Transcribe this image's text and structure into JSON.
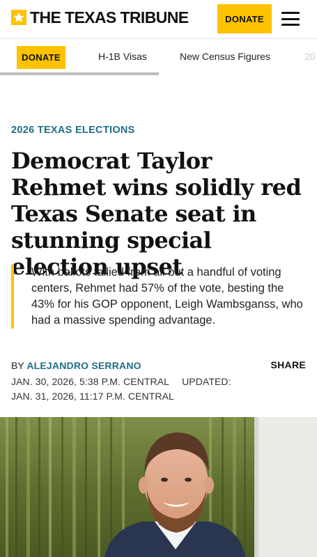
{
  "header": {
    "logo_text": "THE TEXAS TRIBUNE",
    "donate_label": "DONATE"
  },
  "nav": {
    "donate_label": "DONATE",
    "links": [
      "H-1B Visas",
      "New Census Figures",
      "20"
    ]
  },
  "article": {
    "kicker": "2026 TEXAS ELECTIONS",
    "headline": "Democrat Taylor Rehmet wins solidly red Texas Senate seat in stunning special election upset",
    "dek": "With ballots tallied from all but a handful of voting centers, Rehmet had 57% of the vote, besting the 43% for his GOP opponent, Leigh Wambsganss, who had a massive spending advantage.",
    "byline_prefix": "BY",
    "author": "Alejandro Serrano",
    "share_label": "SHARE",
    "published": "JAN. 30, 2026, 5:38 P.M. CENTRAL",
    "updated_label": "UPDATED:",
    "updated": "JAN. 31, 2026, 11:17 P.M. CENTRAL"
  },
  "colors": {
    "accent_yellow": "#ffc200",
    "kicker_teal": "#1f6e86"
  },
  "icons": {
    "logo": "star-icon",
    "menu": "hamburger-menu-icon"
  }
}
